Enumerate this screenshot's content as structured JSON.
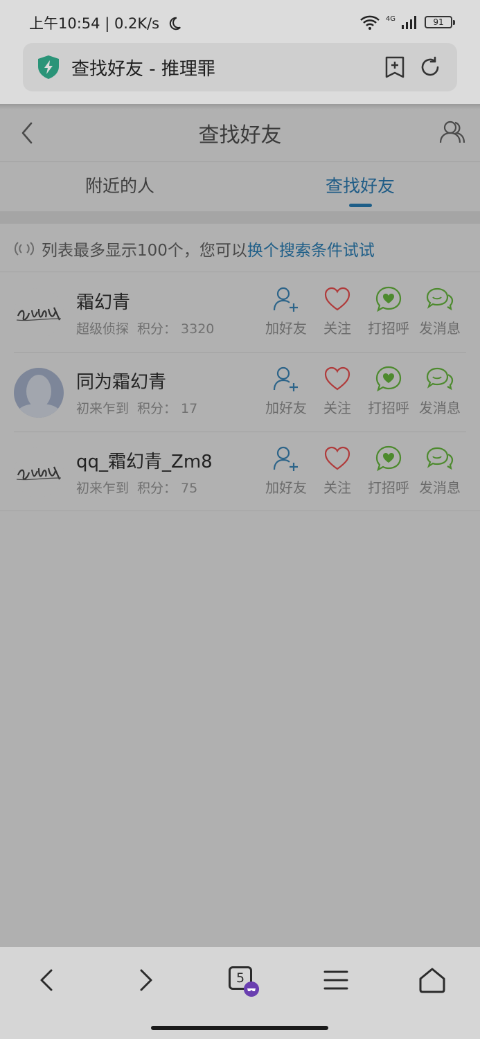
{
  "status_bar": {
    "text": "上午10:54 | 0.2K/s",
    "network": "4G",
    "battery": "91",
    "icons": [
      "moon-icon",
      "wifi-icon",
      "signal-icon",
      "battery-icon"
    ]
  },
  "address_bar": {
    "title": "查找好友 - 推理罪",
    "icons": [
      "shield-icon",
      "bookmark-add-icon",
      "refresh-icon"
    ]
  },
  "nav": {
    "title": "查找好友",
    "icons": [
      "back-icon",
      "friends-icon"
    ]
  },
  "tabs": [
    {
      "label": "附近的人",
      "active": false
    },
    {
      "label": "查找好友",
      "active": true
    }
  ],
  "notice": {
    "prefix": "列表最多显示100个，您可以",
    "link": "换个搜索条件试试"
  },
  "actions": {
    "add_friend": "加好友",
    "follow": "关注",
    "greet": "打招呼",
    "message": "发消息"
  },
  "users": [
    {
      "name": "霜幻青",
      "level": "超级侦探",
      "score_label": "积分：",
      "score": "3320",
      "avatar": "signature"
    },
    {
      "name": "同为霜幻青",
      "level": "初来乍到",
      "score_label": "积分：",
      "score": "17",
      "avatar": "default"
    },
    {
      "name": "qq_霜幻青_Zm8",
      "level": "初来乍到",
      "score_label": "积分：",
      "score": "75",
      "avatar": "signature"
    }
  ],
  "toolbar": {
    "tab_count": "5",
    "icons": [
      "back-icon",
      "forward-icon",
      "tabs-icon",
      "menu-icon",
      "home-icon"
    ]
  },
  "colors": {
    "accent": "#1e5e88",
    "heart": "#b03a3a",
    "green": "#4d8a2e",
    "blue_icon": "#2c6489"
  }
}
